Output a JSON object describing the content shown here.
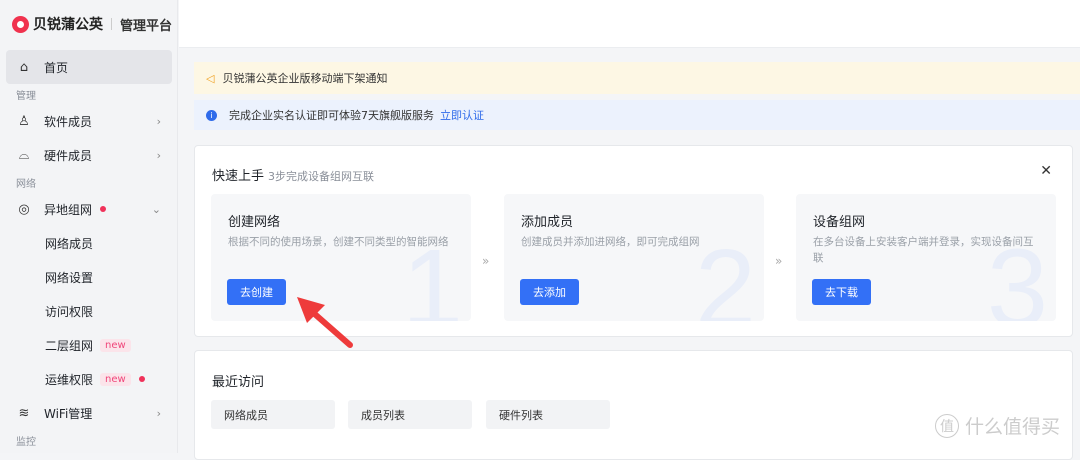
{
  "brand": {
    "name": "贝锐蒲公英",
    "sub": "管理平台"
  },
  "sidebar": {
    "home": "首页",
    "sections": [
      "管理",
      "网络",
      "监控"
    ],
    "items": [
      {
        "label": "软件成员"
      },
      {
        "label": "硬件成员"
      },
      {
        "label": "异地组网"
      },
      {
        "label": "网络成员"
      },
      {
        "label": "网络设置"
      },
      {
        "label": "访问权限"
      },
      {
        "label": "二层组网",
        "badge": "new"
      },
      {
        "label": "运维权限",
        "badge": "new"
      },
      {
        "label": "WiFi管理"
      }
    ]
  },
  "notice": "贝锐蒲公英企业版移动端下架通知",
  "info": {
    "text": "完成企业实名认证即可体验7天旗舰版服务",
    "link": "立即认证"
  },
  "quickstart": {
    "title": "快速上手",
    "subtitle": "3步完成设备组网互联",
    "steps": [
      {
        "title": "创建网络",
        "desc": "根据不同的使用场景，创建不同类型的智能网络",
        "button": "去创建",
        "num": "1"
      },
      {
        "title": "添加成员",
        "desc": "创建成员并添加进网络，即可完成组网",
        "button": "去添加",
        "num": "2"
      },
      {
        "title": "设备组网",
        "desc": "在多台设备上安装客户端并登录，实现设备间互联",
        "button": "去下载",
        "num": "3"
      }
    ]
  },
  "recent": {
    "title": "最近访问",
    "items": [
      "网络成员",
      "成员列表",
      "硬件列表"
    ]
  },
  "watermark": {
    "circle": "值",
    "text": "什么值得买"
  },
  "colors": {
    "accent": "#3370f6",
    "dot": "#f0325a",
    "arrow": "#ee3b3b"
  }
}
